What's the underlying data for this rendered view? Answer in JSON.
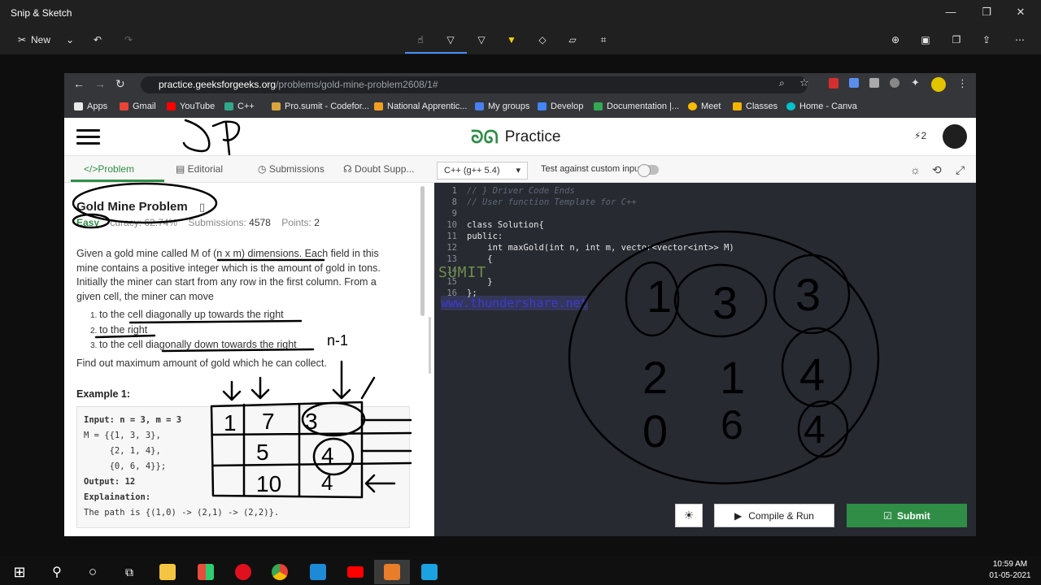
{
  "app": {
    "title": "Snip & Sketch"
  },
  "toolbar": {
    "new_label": "New"
  },
  "browser": {
    "url_host": "practice.geeksforgeeks.org",
    "url_path": "/problems/gold-mine-problem2608/1#",
    "bookmarks": [
      "Apps",
      "Gmail",
      "YouTube",
      "C++",
      "Pro.sumit - Codefor...",
      "National Apprentic...",
      "My groups",
      "Develop",
      "Documentation |...",
      "Meet",
      "Classes",
      "Home - Canva"
    ]
  },
  "site": {
    "logo_text": "Practice",
    "streak": "2",
    "tabs": [
      "Problem",
      "Editorial",
      "Submissions",
      "Doubt Supp..."
    ],
    "language": "C++ (g++ 5.4)",
    "custom_input_label": "Test against custom input"
  },
  "problem": {
    "title": "Gold Mine Problem",
    "difficulty": "Easy",
    "accuracy": "curacy: 62.74%",
    "submissions_label": "Submissions:",
    "submissions_value": "4578",
    "points_label": "Points:",
    "points_value": "2",
    "description": [
      "Given a gold mine called M of (n x m) dimensions. Each field in this",
      "mine contains a positive integer which is the amount of gold in tons.",
      "Initially the miner can start from any row in the first column. From a",
      "given cell, the miner can move"
    ],
    "steps": [
      "to the cell diagonally up towards the right",
      "to the right",
      "to the cell diagonally down towards the right"
    ],
    "find_out": "Find out maximum amount of gold which he can collect.",
    "example_heading": "Example 1:",
    "example_lines": [
      "Input: n = 3, m = 3",
      "M = {{1, 3, 3},",
      "     {2, 1, 4},",
      "     {0, 6, 4}};",
      "Output: 12",
      "Explaination:",
      "The path is {(1,0) -> (2,1) -> (2,2)}."
    ]
  },
  "editor": {
    "line_numbers": [
      "1",
      "8",
      "9",
      "10",
      "11",
      "12",
      "13",
      "14",
      "15",
      "16"
    ],
    "lines": [
      "// } Driver Code Ends",
      "// User function Template for C++",
      "",
      "class Solution{",
      "public:",
      "    int maxGold(int n, int m, vector<vector<int>> M)",
      "    {",
      "",
      "    }",
      "};"
    ],
    "watermark1": "SUMIT",
    "watermark2": "www.thundershare.net",
    "run_label": "Compile & Run",
    "submit_label": "Submit"
  },
  "annotations": {
    "dp_note": "DP",
    "n_minus_1": "n-1",
    "grid_left": [
      "1",
      "7",
      "3",
      "5",
      "4",
      "10",
      "4"
    ],
    "grid_right": [
      "1",
      "3",
      "3",
      "2",
      "1",
      "4",
      "0",
      "6",
      "4"
    ]
  },
  "taskbar": {
    "time": "10:59 AM",
    "date": "01-05-2021"
  }
}
